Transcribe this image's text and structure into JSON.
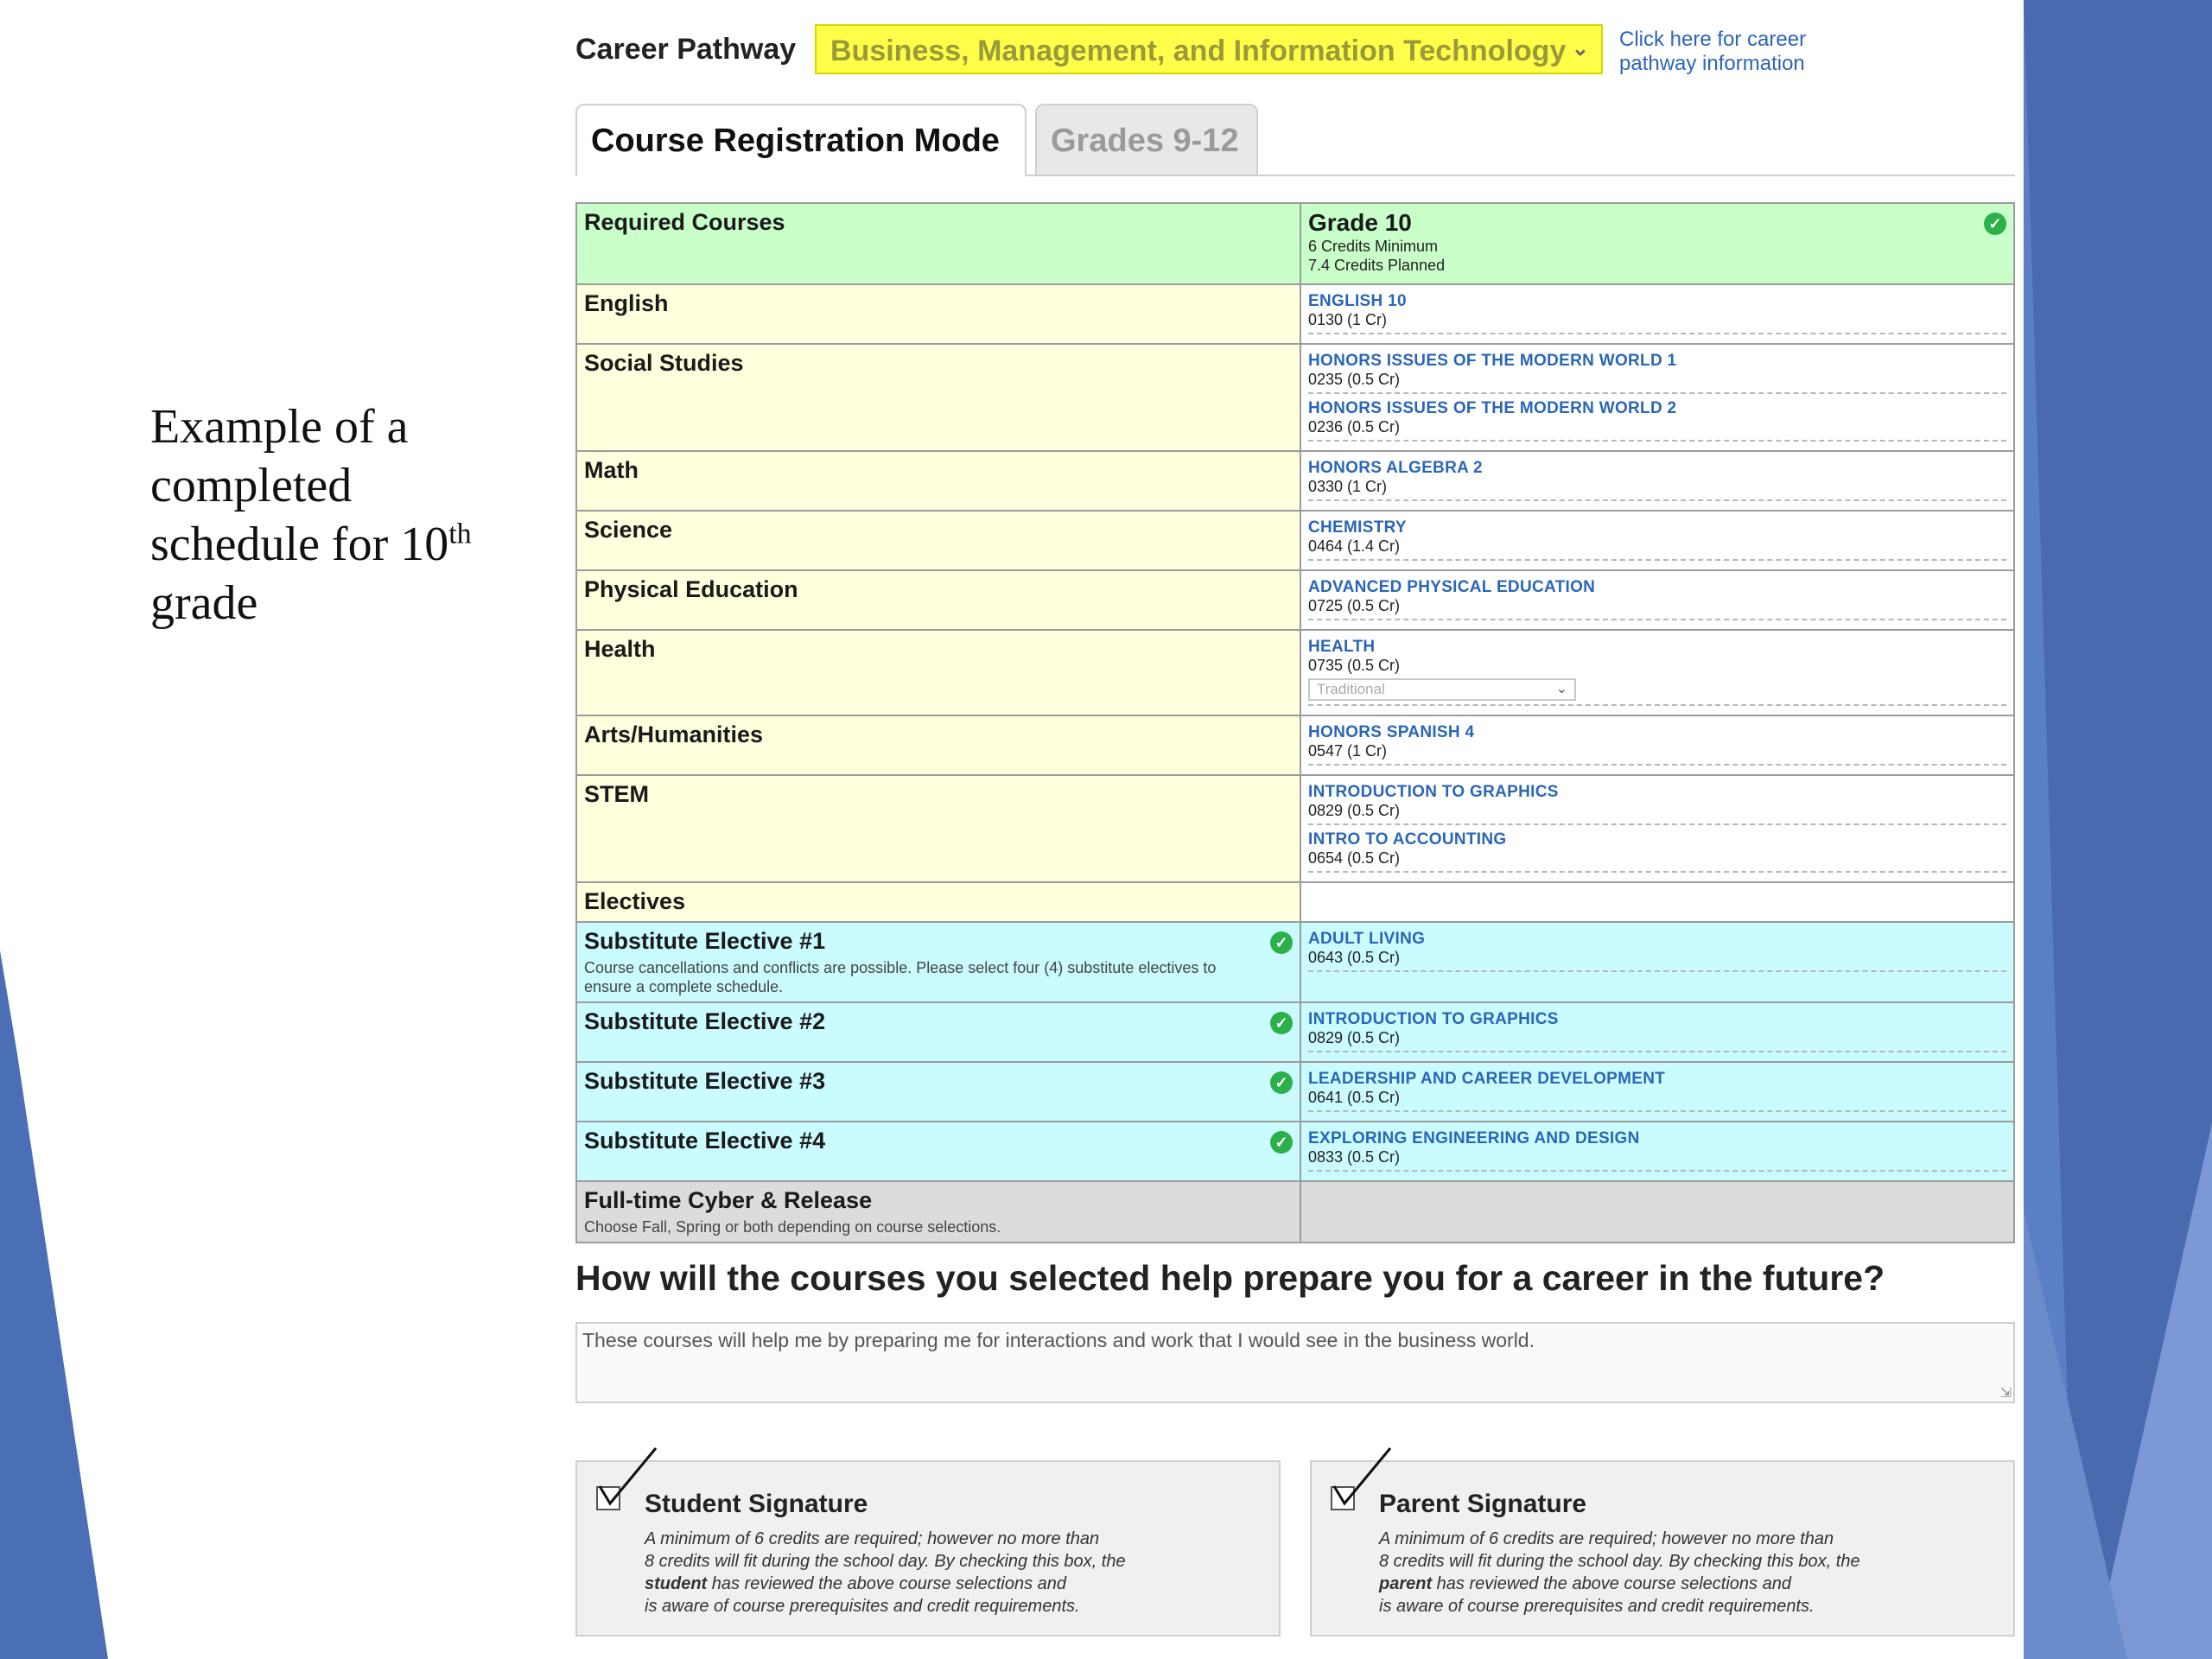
{
  "slide": {
    "caption_main": "Example of a completed schedule for 10",
    "caption_sup": "th",
    "caption_end": "grade"
  },
  "pathway": {
    "label": "Career Pathway",
    "selected": "Business, Management, and Information Technology",
    "link": "Click here for career pathway information"
  },
  "tabs": [
    {
      "label": "Course Registration Mode"
    },
    {
      "label": "Grades 9-12"
    }
  ],
  "table": {
    "header_left": "Required Courses",
    "grade_title": "Grade 10",
    "credits_min": "6 Credits Minimum",
    "credits_planned": "7.4 Credits Planned",
    "rows": [
      {
        "category": "English",
        "courses": [
          {
            "name": "ENGLISH 10",
            "meta": "0130 (1 Cr)"
          }
        ]
      },
      {
        "category": "Social Studies",
        "courses": [
          {
            "name": "HONORS ISSUES OF THE MODERN WORLD 1",
            "meta": "0235 (0.5 Cr)"
          },
          {
            "name": "HONORS ISSUES OF THE MODERN WORLD 2",
            "meta": "0236 (0.5 Cr)"
          }
        ]
      },
      {
        "category": "Math",
        "courses": [
          {
            "name": "HONORS ALGEBRA 2",
            "meta": "0330 (1 Cr)"
          }
        ]
      },
      {
        "category": "Science",
        "courses": [
          {
            "name": "CHEMISTRY",
            "meta": "0464 (1.4 Cr)"
          }
        ]
      },
      {
        "category": "Physical Education",
        "courses": [
          {
            "name": "ADVANCED PHYSICAL EDUCATION",
            "meta": "0725 (0.5 Cr)"
          }
        ]
      },
      {
        "category": "Health",
        "courses": [
          {
            "name": "HEALTH",
            "meta": "0735 (0.5 Cr)",
            "option": "Traditional"
          }
        ]
      },
      {
        "category": "Arts/Humanities",
        "courses": [
          {
            "name": "HONORS SPANISH 4",
            "meta": "0547 (1 Cr)"
          }
        ]
      },
      {
        "category": "STEM",
        "courses": [
          {
            "name": "INTRODUCTION TO GRAPHICS",
            "meta": "0829 (0.5 Cr)"
          },
          {
            "name": "INTRO TO ACCOUNTING",
            "meta": "0654 (0.5 Cr)"
          }
        ]
      },
      {
        "category": "Electives"
      }
    ],
    "substitutes": [
      {
        "label": "Substitute Elective #1",
        "note": "Course cancellations and conflicts are possible. Please select four (4) substitute electives to ensure a complete schedule.",
        "course": "ADULT LIVING",
        "meta": "0643 (0.5 Cr)"
      },
      {
        "label": "Substitute Elective #2",
        "course": "INTRODUCTION TO GRAPHICS",
        "meta": "0829 (0.5 Cr)"
      },
      {
        "label": "Substitute Elective #3",
        "course": "LEADERSHIP AND CAREER DEVELOPMENT",
        "meta": "0641 (0.5 Cr)"
      },
      {
        "label": "Substitute Elective #4",
        "course": "EXPLORING ENGINEERING AND DESIGN",
        "meta": "0833 (0.5 Cr)"
      }
    ],
    "cyber": {
      "label": "Full-time Cyber & Release",
      "note": "Choose Fall, Spring or both depending on course selections."
    }
  },
  "question": {
    "text": "How will the courses you selected help prepare you for a career in the future?",
    "answer": "These courses will help me by preparing me for interactions and work that I would see in the business world."
  },
  "signatures": {
    "student": {
      "title": "Student Signature",
      "line1": "A minimum of 6 credits are required; however no more than",
      "line2": "8 credits will fit during the school day.  By checking this box, the",
      "who": "student",
      "line3": " has reviewed the above course selections and",
      "line4": "is aware of course prerequisites and credit requirements."
    },
    "parent": {
      "title": "Parent Signature",
      "line1": "A minimum of 6 credits are required; however no more than",
      "line2": "8 credits will fit during the school day.  By checking this box, the",
      "who": "parent",
      "line3": " has reviewed the above course selections and",
      "line4": "is aware of course prerequisites and credit requirements."
    }
  },
  "colors": {
    "pathway_bg": "#ffff4a",
    "required_bg": "#c9ffc9",
    "category_bg": "#ffffdd",
    "substitute_bg": "#c9fbff",
    "cyber_bg": "#dcdcdc",
    "link": "#2a66b8",
    "check": "#2bb04a",
    "slide_blue": "#4a6fb5"
  },
  "icons": [
    "check-circle-icon",
    "chevron-down-icon",
    "checkbox-checkmark-icon",
    "resize-grip-icon"
  ]
}
